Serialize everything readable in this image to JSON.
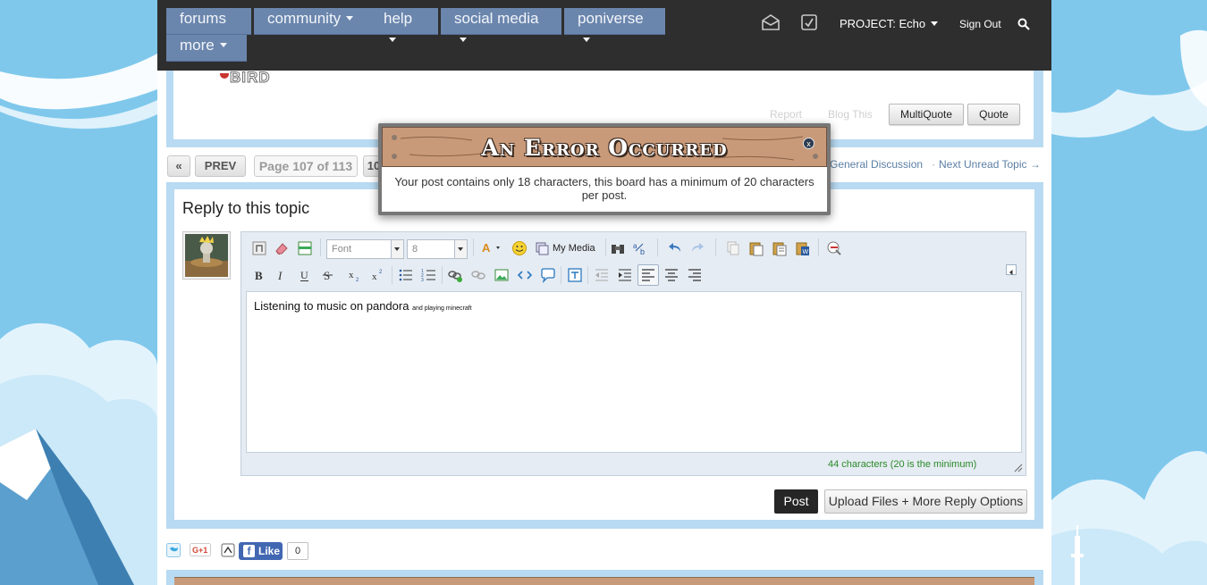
{
  "colors": {
    "sky": "#7fc8ec",
    "topbar": "#2e2e2e",
    "nav_tab": "#6b86ad",
    "frame": "#b8daf2",
    "modal_header": "#c99a79",
    "ok_text": "#2a8a2a"
  },
  "nav": {
    "tabs": [
      {
        "label": "forums"
      },
      {
        "label": "community"
      },
      {
        "label": "help"
      },
      {
        "label": "social media"
      },
      {
        "label": "poniverse"
      },
      {
        "label": "more"
      }
    ],
    "project_label": "PROJECT: Echo",
    "sign_out": "Sign Out",
    "icons": [
      "envelope-icon",
      "notification-icon",
      "search-icon"
    ]
  },
  "post": {
    "logo_text": "BIRD",
    "report": "Report",
    "blog_this": "Blog This",
    "multiquote": "MultiQuote",
    "quote": "Quote"
  },
  "pagination": {
    "first": "«",
    "prev": "PREV",
    "current": "Page 107 of 113",
    "partial_page": "10",
    "forum_link": "General Discussion",
    "separator": "·",
    "next_unread": "Next Unread Topic →"
  },
  "reply": {
    "title": "Reply to this topic",
    "font_placeholder": "Font",
    "size_value": "8",
    "my_media": "My Media",
    "content_main": "Listening to music on pandora",
    "content_small": "and playing minecraft",
    "char_count": "44 characters (20 is the minimum)",
    "post_button": "Post",
    "upload_button": "Upload Files + More Reply Options"
  },
  "share": {
    "like_label": "Like",
    "like_count": "0",
    "google_label": "G+1"
  },
  "modal": {
    "title": "An Error Occurred",
    "close": "x",
    "message": "Your post contains only 18 characters, this board has a minimum of 20 characters per post."
  }
}
